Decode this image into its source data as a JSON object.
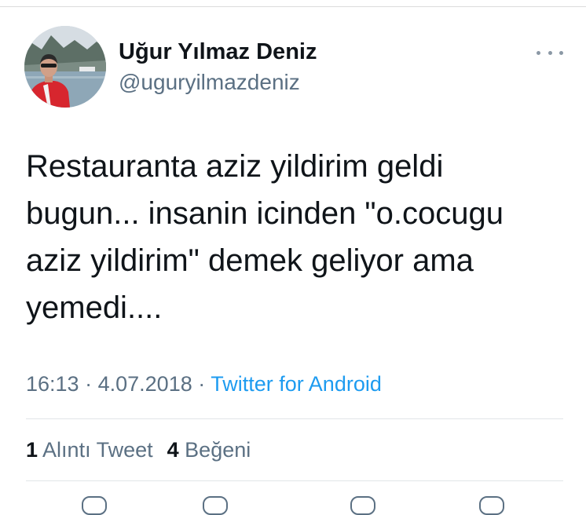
{
  "author": {
    "name": "Uğur Yılmaz Deniz",
    "handle": "@uguryilmazdeniz",
    "avatar_icon": "profile-photo"
  },
  "tweet": {
    "text": "Restauranta aziz yildirim geldi\nbugun... insanin icinden \"o.cocugu\naziz yildirim\" demek geliyor ama\nyemedi...."
  },
  "meta": {
    "time": "16:13",
    "separator": "·",
    "date": "4.07.2018",
    "source": "Twitter for Android"
  },
  "stats": {
    "quotes_count": "1",
    "quotes_label": "Alıntı Tweet",
    "likes_count": "4",
    "likes_label": "Beğeni"
  },
  "colors": {
    "text": "#0f1419",
    "secondary": "#5b7083",
    "link": "#1d9bf0"
  }
}
